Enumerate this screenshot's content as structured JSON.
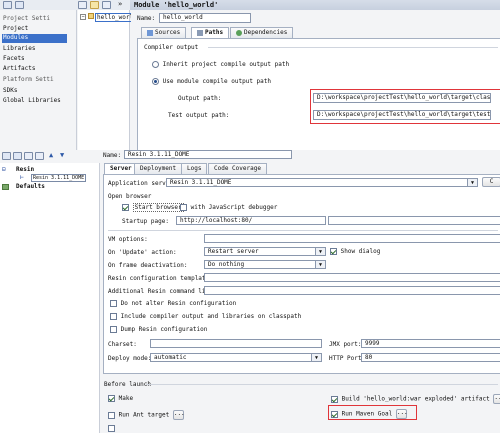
{
  "top": {
    "module_title": "Module 'hello_world'",
    "tree": [
      "Project Setti",
      "Project",
      "Modules",
      "Libraries",
      "Facets",
      "Artifacts",
      "Platform Setti",
      "SDKs",
      "Global Libraries"
    ],
    "module_node": "hello_world",
    "name_label": "Name:",
    "name_value": "hello_world",
    "tabs": [
      "Sources",
      "Paths",
      "Dependencies"
    ],
    "compiler_output": "Compiler output",
    "inherit_label": "Inherit project compile output path",
    "use_module_label": "Use module compile output path",
    "output_label": "Output path:",
    "output_value": "D:\\workspace\\projectTest\\hello_world\\target\\classes",
    "test_label": "Test output path:",
    "test_value": "D:\\workspace\\projectTest\\hello_world\\target\\test-classes",
    "colors": {
      "highlight": "#e0353a",
      "selection": "#3b70c9"
    }
  },
  "bottom": {
    "name_label": "Name:",
    "name_value": "Resin 3.1.11_DOME",
    "tree": {
      "root": "Resin",
      "child": "Resin 3.1.11_DOME",
      "defaults": "Defaults"
    },
    "tabs": [
      "Server",
      "Deployment",
      "Logs",
      "Code Coverage"
    ],
    "app_server_label": "Application server:",
    "app_server_value": "Resin 3.1.11_DOME",
    "open_browser": "Open browser",
    "start_browser": "Start browser",
    "js_debugger": "with JavaScript debugger",
    "startup_label": "Startup page:",
    "startup_value": "http://localhost:80/",
    "vm_options": "VM options:",
    "on_update_label": "On 'Update' action:",
    "on_update_value": "Restart server",
    "show_dialog": "Show dialog",
    "on_frame_label": "On frame deactivation:",
    "on_frame_value": "Do nothing",
    "resin_conf": "Resin configuration template:",
    "additional": "Additional Resin command line:",
    "do_not_alter": "Do not alter Resin configuration",
    "include_compiler": "Include compiler output and libraries on classpath",
    "dump_resin": "Dump Resin configuration",
    "charset_label": "Charset:",
    "jmx_label": "JMX port:",
    "jmx_value": "9999",
    "deploy_label": "Deploy mode:",
    "deploy_value": "automatic",
    "http_label": "HTTP Port:",
    "http_value": "80",
    "before_launch": "Before launch",
    "make": "Make",
    "build_artifact": "Build 'hello_world:war exploded' artifact",
    "run_ant": "Run Ant target",
    "run_maven": "Run Maven Goal",
    "ellipsis": "..."
  }
}
